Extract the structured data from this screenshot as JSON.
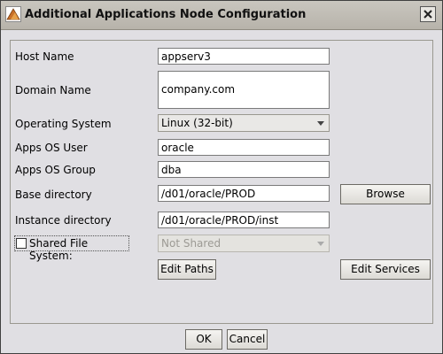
{
  "window": {
    "title": "Additional Applications Node Configuration"
  },
  "form": {
    "host_name": {
      "label": "Host Name",
      "value": "appserv3"
    },
    "domain_name": {
      "label": "Domain Name",
      "value": "company.com"
    },
    "operating_system": {
      "label": "Operating System",
      "value": "Linux (32-bit)"
    },
    "apps_os_user": {
      "label": "Apps OS User",
      "value": "oracle"
    },
    "apps_os_group": {
      "label": "Apps OS Group",
      "value": "dba"
    },
    "base_directory": {
      "label": "Base directory",
      "value": "/d01/oracle/PROD"
    },
    "instance_directory": {
      "label": "Instance directory",
      "value": "/d01/oracle/PROD/inst"
    },
    "shared_file_system": {
      "label": "Shared File System:",
      "checked": false,
      "value": "Not Shared"
    }
  },
  "buttons": {
    "browse": "Browse",
    "edit_paths": "Edit Paths",
    "edit_services": "Edit Services",
    "ok": "OK",
    "cancel": "Cancel"
  }
}
